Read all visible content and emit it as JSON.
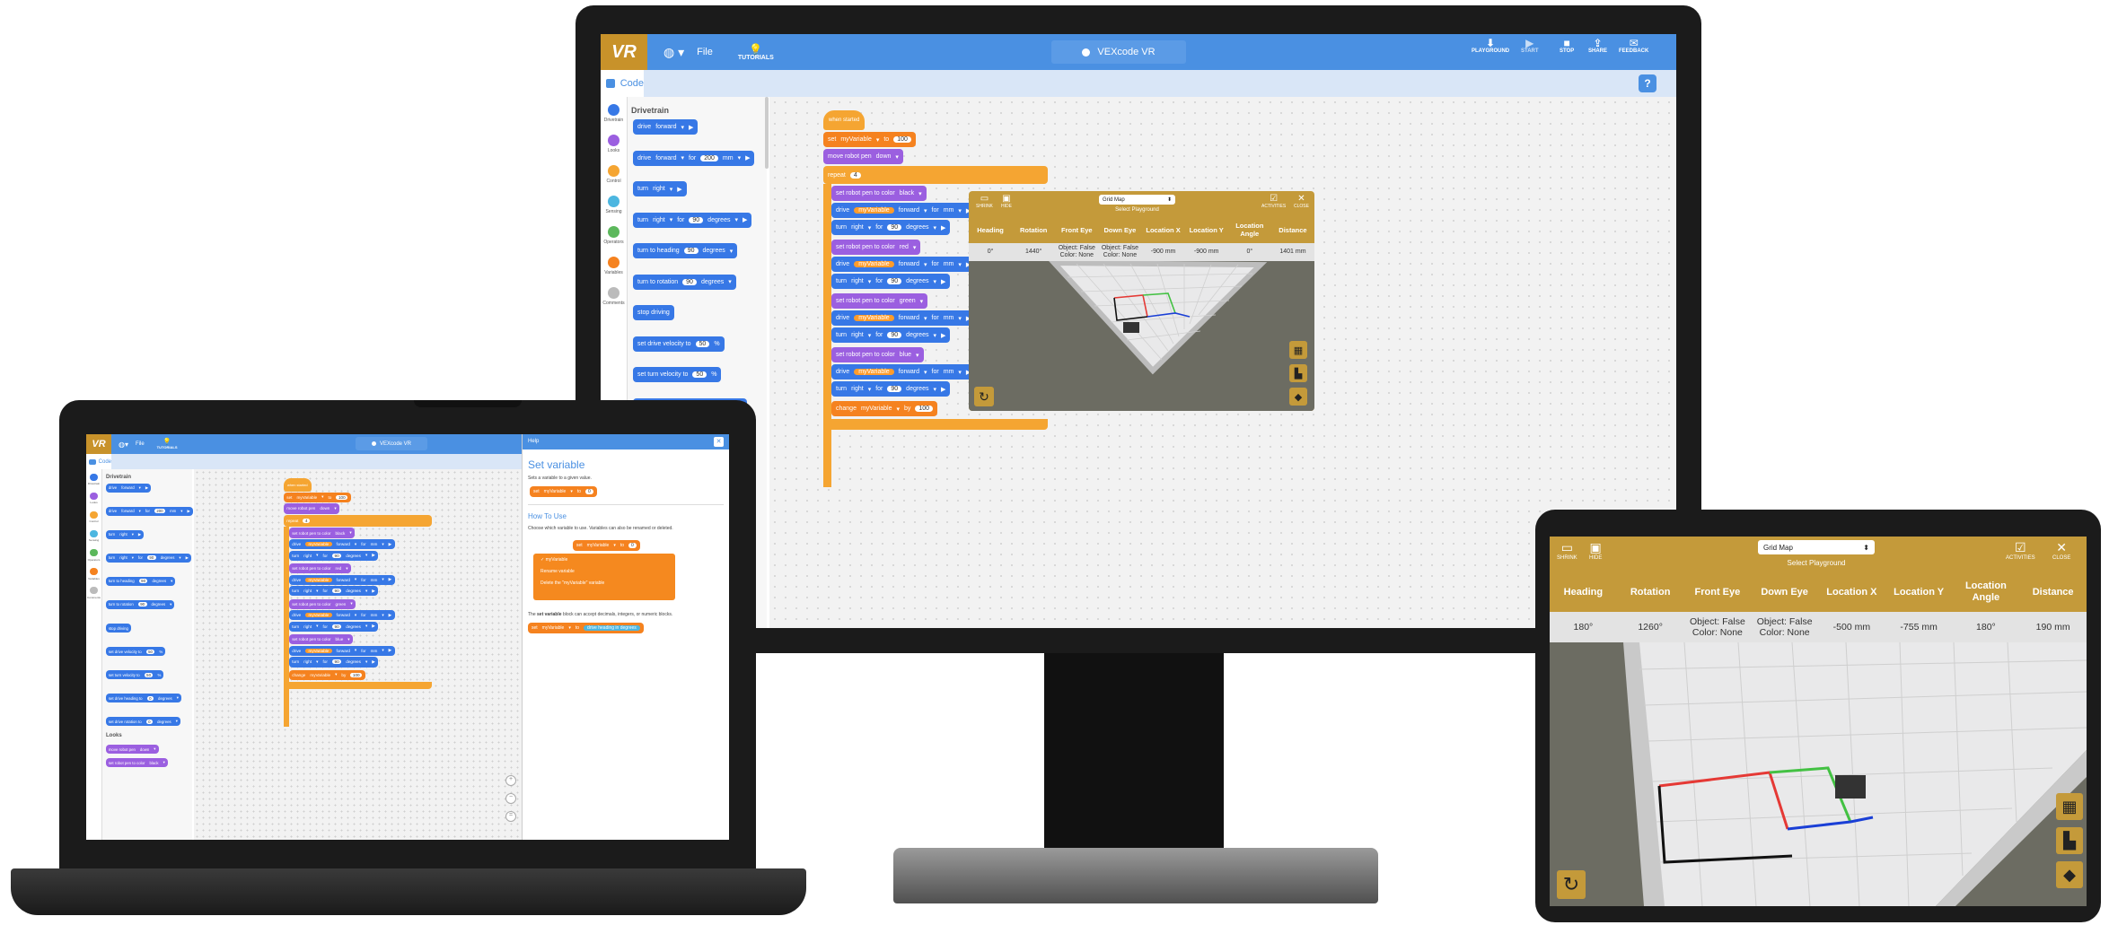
{
  "app": {
    "logo": "VR",
    "file_label": "File",
    "tutorials_label": "TUTORIALS",
    "project_name": "VEXcode VR",
    "toolbar": {
      "playground": "PLAYGROUND",
      "start": "START",
      "stop": "STOP",
      "shared": "SHARE",
      "feedback": "FEEDBACK"
    },
    "code_tab": "Code",
    "icons": [
      "globe-icon",
      "lightbulb-icon",
      "download-icon",
      "play-icon",
      "stop-icon",
      "share-icon",
      "feedback-icon",
      "help-icon"
    ]
  },
  "categories": [
    {
      "label": "Drivetrain",
      "color": "#3778e6"
    },
    {
      "label": "Looks",
      "color": "#9b5fe0"
    },
    {
      "label": "Control",
      "color": "#f5a532"
    },
    {
      "label": "Sensing",
      "color": "#4cb6e0"
    },
    {
      "label": "Operators",
      "color": "#5cb85c"
    },
    {
      "label": "Variables",
      "color": "#f5821f"
    },
    {
      "label": "Comments",
      "color": "#bbbbbb"
    }
  ],
  "palette": {
    "heading": "Drivetrain",
    "looks_heading": "Looks",
    "blocks": [
      {
        "text": "drive",
        "dd": "forward"
      },
      {
        "text": "drive",
        "dd": "forward",
        "for": "for",
        "num": "200",
        "unit": "mm"
      },
      {
        "text": "turn",
        "dd": "right"
      },
      {
        "text": "turn",
        "dd": "right",
        "for": "for",
        "num": "90",
        "unit": "degrees"
      },
      {
        "text": "turn to heading",
        "num": "90",
        "unit": "degrees"
      },
      {
        "text": "turn to rotation",
        "num": "90",
        "unit": "degrees"
      },
      {
        "text": "stop driving"
      },
      {
        "text": "set drive velocity to",
        "num": "50",
        "unit": "%"
      },
      {
        "text": "set turn velocity to",
        "num": "50",
        "unit": "%"
      },
      {
        "text": "set drive heading to",
        "num": "0",
        "unit": "degrees"
      },
      {
        "text": "set drive rotation to",
        "num": "0",
        "unit": "degrees"
      }
    ],
    "looks_blocks": [
      {
        "text": "move robot pen",
        "dd": "down"
      },
      {
        "text": "set robot pen to color",
        "dd": "black"
      }
    ]
  },
  "script": {
    "hat": "when started",
    "set": {
      "text": "set",
      "var": "myVariable",
      "to": "to",
      "num": "100"
    },
    "pen": {
      "text": "move robot pen",
      "dd": "down"
    },
    "repeat": {
      "text": "repeat",
      "num": "4"
    },
    "colors": [
      "black",
      "red",
      "green",
      "blue"
    ],
    "color_block": "set robot pen to color",
    "drive": {
      "text": "drive",
      "dd": "forward",
      "for": "for",
      "var": "myVariable",
      "unit": "mm"
    },
    "turn": {
      "text": "turn",
      "dd": "right",
      "for": "for",
      "num": "90",
      "unit": "degrees"
    },
    "change": {
      "text": "change",
      "var": "myVariable",
      "by": "by",
      "num": "100"
    }
  },
  "playground": {
    "select_label": "Grid Map",
    "select_caption": "Select Playground",
    "buttons": {
      "shrink": "SHRINK",
      "hide": "HIDE",
      "activities": "ACTIVITIES",
      "close": "CLOSE"
    },
    "headers": [
      "Heading",
      "Rotation",
      "Front Eye",
      "Down Eye",
      "Location X",
      "Location Y",
      "Location Angle",
      "Distance"
    ],
    "monitor_values": [
      "0°",
      "1440°",
      "Object: False Color: None",
      "Object: False Color: None",
      "-900 mm",
      "-900 mm",
      "0°",
      "1401 mm"
    ],
    "tablet_values": [
      "180°",
      "1260°",
      "Object: False Color: None",
      "Object: False Color: None",
      "-500 mm",
      "-755 mm",
      "180°",
      "190 mm"
    ],
    "colors": {
      "gold": "#c49a3a",
      "line_red": "#e53935",
      "line_green": "#43c143",
      "line_blue": "#1a3fd6"
    }
  },
  "help": {
    "title": "Help",
    "heading": "Set variable",
    "desc": "Sets a variable to a given value.",
    "how_to": "How To Use",
    "how_desc": "Choose which variable to use. Variables can also be renamed or deleted.",
    "block": {
      "text": "set",
      "var": "myVariable",
      "to": "to",
      "num": "0"
    },
    "menu": [
      "myVariable",
      "Rename variable",
      "Delete the \"myVariable\" variable"
    ],
    "footer_pre": "The",
    "footer_bold": "set variable",
    "footer_post": "block can accept decimals, integers, or numeric blocks.",
    "example": {
      "text": "set",
      "var": "myVariable",
      "to": "to",
      "val": "drive heading in degrees"
    }
  }
}
